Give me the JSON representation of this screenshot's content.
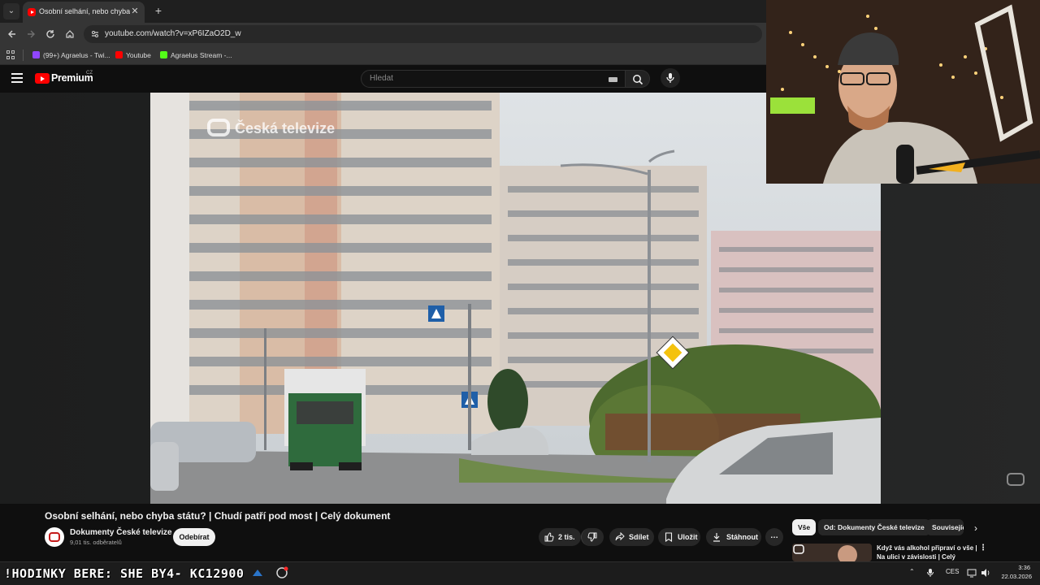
{
  "browser": {
    "tab": {
      "title": "Osobní selhání, nebo chyba státu? | Chudí patří pod most | Celý dokument"
    },
    "tab_list_icon": "chevron-down-icon",
    "new_tab_label": "+",
    "url": "youtube.com/watch?v=xP6IZaO2D_w",
    "bookmarks": [
      {
        "label": "(99+) Agraelus - Twi...",
        "icon": "twitch-icon",
        "color": "#9146ff"
      },
      {
        "label": "Youtube",
        "icon": "youtube-icon",
        "color": "#ff0000"
      },
      {
        "label": "Agraelus Stream -...",
        "icon": "kick-icon",
        "color": "#53fc18"
      }
    ]
  },
  "youtube": {
    "logo_text": "Premium",
    "country_code": "CZ",
    "search_placeholder": "Hledat"
  },
  "player": {
    "watermark": "Česká televize"
  },
  "video": {
    "title": "Osobní selhání, nebo chyba státu? | Chudí patří pod most | Celý dokument",
    "channel_name": "Dokumenty České televize",
    "subscribers": "9,01 tis. odběratelů",
    "subscribe_label": "Odebírat",
    "like_count": "2 tis.",
    "share_label": "Sdílet",
    "save_label": "Uložit",
    "download_label": "Stáhnout",
    "more_label": "…"
  },
  "sidebar": {
    "chips": [
      {
        "label": "Vše",
        "active": true
      },
      {
        "label": "Od: Dokumenty České televize",
        "active": false
      },
      {
        "label": "Související",
        "active": false
      }
    ],
    "first_recommendation": "Když vás alkohol připraví o vše | Na ulici v závislosti | Celý dokument"
  },
  "taskbar": {
    "ticker_text": "!HODINKY BERE: SHE   BY4- KC12900",
    "language": "CES",
    "time": "3:36",
    "date": "22.03.2026"
  },
  "colors": {
    "accent_red": "#ff0000",
    "background": "#0f0f0f",
    "surface": "#272727"
  }
}
